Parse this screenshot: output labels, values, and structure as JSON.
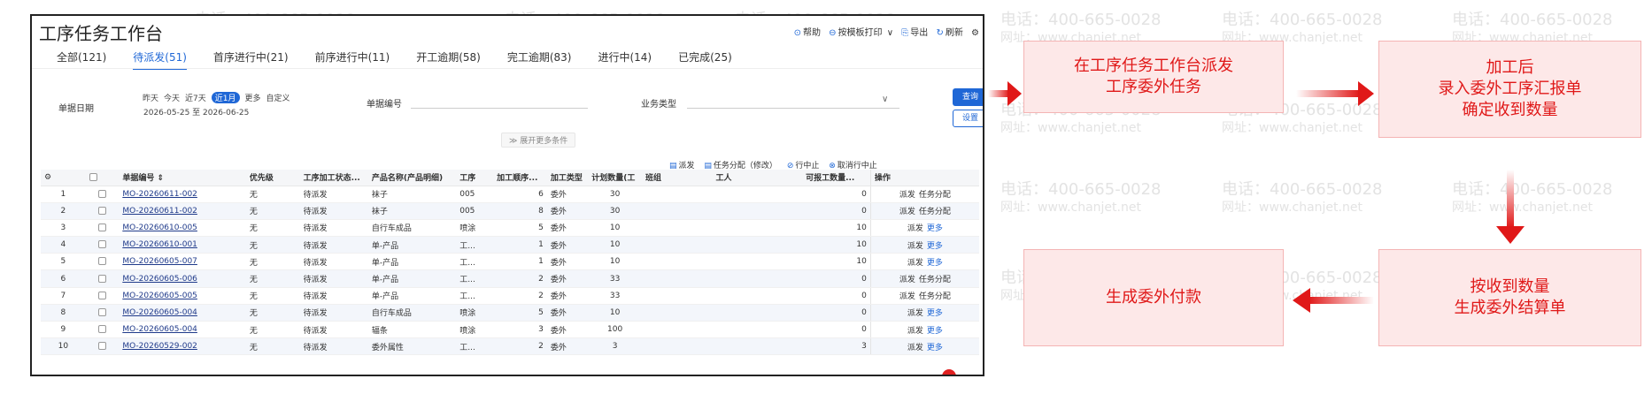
{
  "watermark": {
    "phone": "电话：400-665-0028",
    "site": "网址：www.chanjet.net"
  },
  "app": {
    "title": "工序任务工作台",
    "toolbar": {
      "help": "帮助",
      "print": "按模板打印",
      "export": "导出",
      "refresh": "刷新"
    },
    "tabs": [
      {
        "label": "全部(121)",
        "active": false
      },
      {
        "label": "待派发(51)",
        "active": true
      },
      {
        "label": "首序进行中(21)",
        "active": false
      },
      {
        "label": "前序进行中(11)",
        "active": false
      },
      {
        "label": "开工逾期(58)",
        "active": false
      },
      {
        "label": "完工逾期(83)",
        "active": false
      },
      {
        "label": "进行中(14)",
        "active": false
      },
      {
        "label": "已完成(25)",
        "active": false
      }
    ],
    "filters": {
      "date_label": "单据日期",
      "date_chips": [
        {
          "label": "昨天",
          "on": false
        },
        {
          "label": "今天",
          "on": false
        },
        {
          "label": "近7天",
          "on": false
        },
        {
          "label": "近1月",
          "on": true
        },
        {
          "label": "更多",
          "on": false
        },
        {
          "label": "自定义",
          "on": false
        }
      ],
      "date_range": "2026-05-25 至 2026-06-25",
      "code_label": "单据编号",
      "biz_label": "业务类型",
      "query": "查询",
      "settings": "设置",
      "expand": "展开更多条件"
    },
    "actions": {
      "dispatch": "派发",
      "assign": "任务分配（修改）",
      "stop": "行中止",
      "cancel_stop": "取消行中止"
    },
    "table": {
      "headers": [
        "单据编号 ⇕",
        "优先级",
        "工序加工状态...",
        "产品名称(产品明细)",
        "工序",
        "加工顺序...",
        "加工类型",
        "计划数量(工",
        "班组",
        "工人",
        "可报工数量...",
        "操作"
      ],
      "rows": [
        {
          "no": "1",
          "code": "MO-20260611-002",
          "pri": "无",
          "status": "待派发",
          "product": "袜子",
          "proc": "005",
          "seq": "6",
          "type": "委外",
          "qty": "30",
          "rep": "0",
          "op1": "派发",
          "op2": "任务分配",
          "op2_link": false
        },
        {
          "no": "2",
          "code": "MO-20260611-002",
          "pri": "无",
          "status": "待派发",
          "product": "袜子",
          "proc": "005",
          "seq": "8",
          "type": "委外",
          "qty": "30",
          "rep": "0",
          "op1": "派发",
          "op2": "任务分配",
          "op2_link": false
        },
        {
          "no": "3",
          "code": "MO-20260610-005",
          "pri": "无",
          "status": "待派发",
          "product": "自行车成品",
          "proc": "喷涂",
          "seq": "5",
          "type": "委外",
          "qty": "10",
          "rep": "10",
          "op1": "派发",
          "op2": "更多",
          "op2_link": true
        },
        {
          "no": "4",
          "code": "MO-20260610-001",
          "pri": "无",
          "status": "待派发",
          "product": "单-产品",
          "proc": "工...",
          "seq": "1",
          "type": "委外",
          "qty": "10",
          "rep": "10",
          "op1": "派发",
          "op2": "更多",
          "op2_link": true
        },
        {
          "no": "5",
          "code": "MO-20260605-007",
          "pri": "无",
          "status": "待派发",
          "product": "单-产品",
          "proc": "工...",
          "seq": "1",
          "type": "委外",
          "qty": "10",
          "rep": "10",
          "op1": "派发",
          "op2": "更多",
          "op2_link": true
        },
        {
          "no": "6",
          "code": "MO-20260605-006",
          "pri": "无",
          "status": "待派发",
          "product": "单-产品",
          "proc": "工...",
          "seq": "2",
          "type": "委外",
          "qty": "33",
          "rep": "0",
          "op1": "派发",
          "op2": "任务分配",
          "op2_link": false
        },
        {
          "no": "7",
          "code": "MO-20260605-005",
          "pri": "无",
          "status": "待派发",
          "product": "单-产品",
          "proc": "工...",
          "seq": "2",
          "type": "委外",
          "qty": "33",
          "rep": "0",
          "op1": "派发",
          "op2": "任务分配",
          "op2_link": false
        },
        {
          "no": "8",
          "code": "MO-20260605-004",
          "pri": "无",
          "status": "待派发",
          "product": "自行车成品",
          "proc": "喷涂",
          "seq": "5",
          "type": "委外",
          "qty": "10",
          "rep": "0",
          "op1": "派发",
          "op2": "更多",
          "op2_link": true
        },
        {
          "no": "9",
          "code": "MO-20260605-004",
          "pri": "无",
          "status": "待派发",
          "product": "辐条",
          "proc": "喷涂",
          "seq": "3",
          "type": "委外",
          "qty": "100",
          "rep": "0",
          "op1": "派发",
          "op2": "更多",
          "op2_link": true
        },
        {
          "no": "10",
          "code": "MO-20260529-002",
          "pri": "无",
          "status": "待派发",
          "product": "委外属性",
          "proc": "工...",
          "seq": "2",
          "type": "委外",
          "qty": "3",
          "rep": "3",
          "op1": "派发",
          "op2": "更多",
          "op2_link": true
        }
      ]
    }
  },
  "flow": {
    "step1": [
      "在工序任务工作台派发",
      "工序委外任务"
    ],
    "step2": [
      "加工后",
      "录入委外工序汇报单",
      "确定收到数量"
    ],
    "step3": [
      "按收到数量",
      "生成委外结算单"
    ],
    "step4": [
      "生成委外付款"
    ]
  },
  "colors": {
    "accent": "#1f67d6",
    "flow_red": "#e01818",
    "flow_fill": "#fde8e8"
  }
}
